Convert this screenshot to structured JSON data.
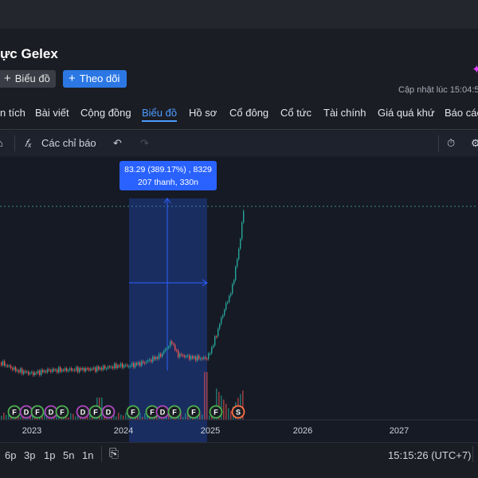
{
  "header": {
    "title": "ực Gelex",
    "chart_button": "Biểu đồ",
    "follow_button": "Theo dõi",
    "updated": "Cập nhật lúc  15:04:5"
  },
  "tabs": [
    "n tích",
    "Bài viết",
    "Cộng đồng",
    "Biểu đồ",
    "Hồ sơ",
    "Cổ đông",
    "Cổ tức",
    "Tài chính",
    "Giá quá khứ",
    "Báo các"
  ],
  "active_tab": "Biểu đồ",
  "toolbar": {
    "indicators": "Các chỉ báo"
  },
  "chart": {
    "measure_line1": "83.29 (389.17%) , 8329",
    "measure_line2": "207 thanh, 330n",
    "x_labels": [
      "2023",
      "2024",
      "2025",
      "2026",
      "2027"
    ],
    "event_markers": [
      "F",
      "D",
      "F",
      "D",
      "F",
      "D",
      "F",
      "D",
      "F",
      "F",
      "D",
      "F",
      "F",
      "F",
      "S"
    ],
    "colors": {
      "up": "#26a69a",
      "down": "#ef5350",
      "selection": "#2962ff",
      "label_bg": "#2962ff"
    }
  },
  "bottom": {
    "timeframes": [
      "6p",
      "3p",
      "1p",
      "5n",
      "1n"
    ],
    "clock": "15:15:26 (UTC+7)"
  }
}
